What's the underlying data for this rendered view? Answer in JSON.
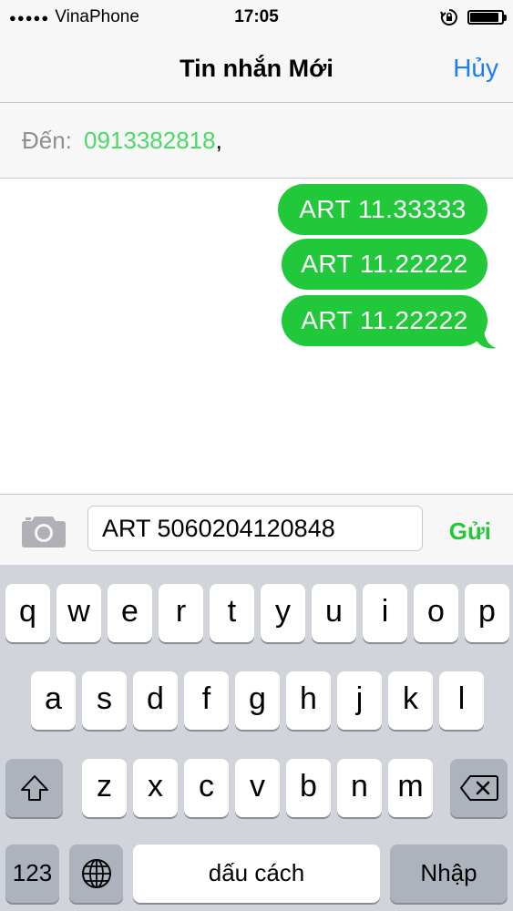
{
  "status_bar": {
    "carrier": "VinaPhone",
    "time": "17:05",
    "battery_level": 0.9
  },
  "nav": {
    "title": "Tin nhắn Mới",
    "cancel_label": "Hủy"
  },
  "recipient": {
    "label": "Đến:",
    "number": "0913382818",
    "separator": ","
  },
  "messages": [
    {
      "text": "ART 11.33333",
      "direction": "outgoing"
    },
    {
      "text": "ART 11.22222",
      "direction": "outgoing"
    },
    {
      "text": "ART 11.22222",
      "direction": "outgoing"
    }
  ],
  "composer": {
    "text": "ART 5060204120848",
    "send_label": "Gửi",
    "camera_icon": "camera-icon"
  },
  "keyboard": {
    "row1": [
      "q",
      "w",
      "e",
      "r",
      "t",
      "y",
      "u",
      "i",
      "o",
      "p"
    ],
    "row2": [
      "a",
      "s",
      "d",
      "f",
      "g",
      "h",
      "j",
      "k",
      "l"
    ],
    "row3": [
      "z",
      "x",
      "c",
      "v",
      "b",
      "n",
      "m"
    ],
    "numbers_label": "123",
    "space_label": "dấu cách",
    "return_label": "Nhập",
    "shift_icon": "shift-icon",
    "delete_icon": "backspace-icon",
    "globe_icon": "globe-icon"
  },
  "colors": {
    "bubble": "#20c83a",
    "accent": "#1a7df5",
    "recipient": "#4cd964"
  }
}
